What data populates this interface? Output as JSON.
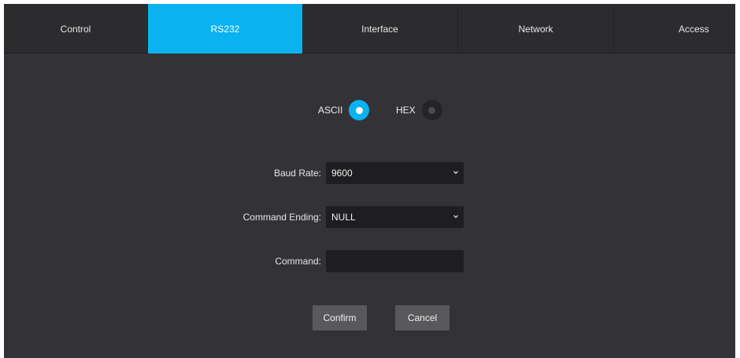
{
  "tabs": [
    {
      "label": "Control"
    },
    {
      "label": "RS232"
    },
    {
      "label": "Interface"
    },
    {
      "label": "Network"
    },
    {
      "label": "Access"
    }
  ],
  "active_tab": "RS232",
  "mode": {
    "ascii_label": "ASCII",
    "hex_label": "HEX",
    "selected": "ASCII"
  },
  "form": {
    "baud_rate_label": "Baud Rate:",
    "baud_rate_value": "9600",
    "command_ending_label": "Command Ending:",
    "command_ending_value": "NULL",
    "command_label": "Command:",
    "command_value": ""
  },
  "buttons": {
    "confirm": "Confirm",
    "cancel": "Cancel"
  },
  "colors": {
    "accent": "#0ab2f0",
    "background": "#333236",
    "tabbar": "#2c2c2f",
    "input": "#1e1e21",
    "button": "#59595c"
  }
}
